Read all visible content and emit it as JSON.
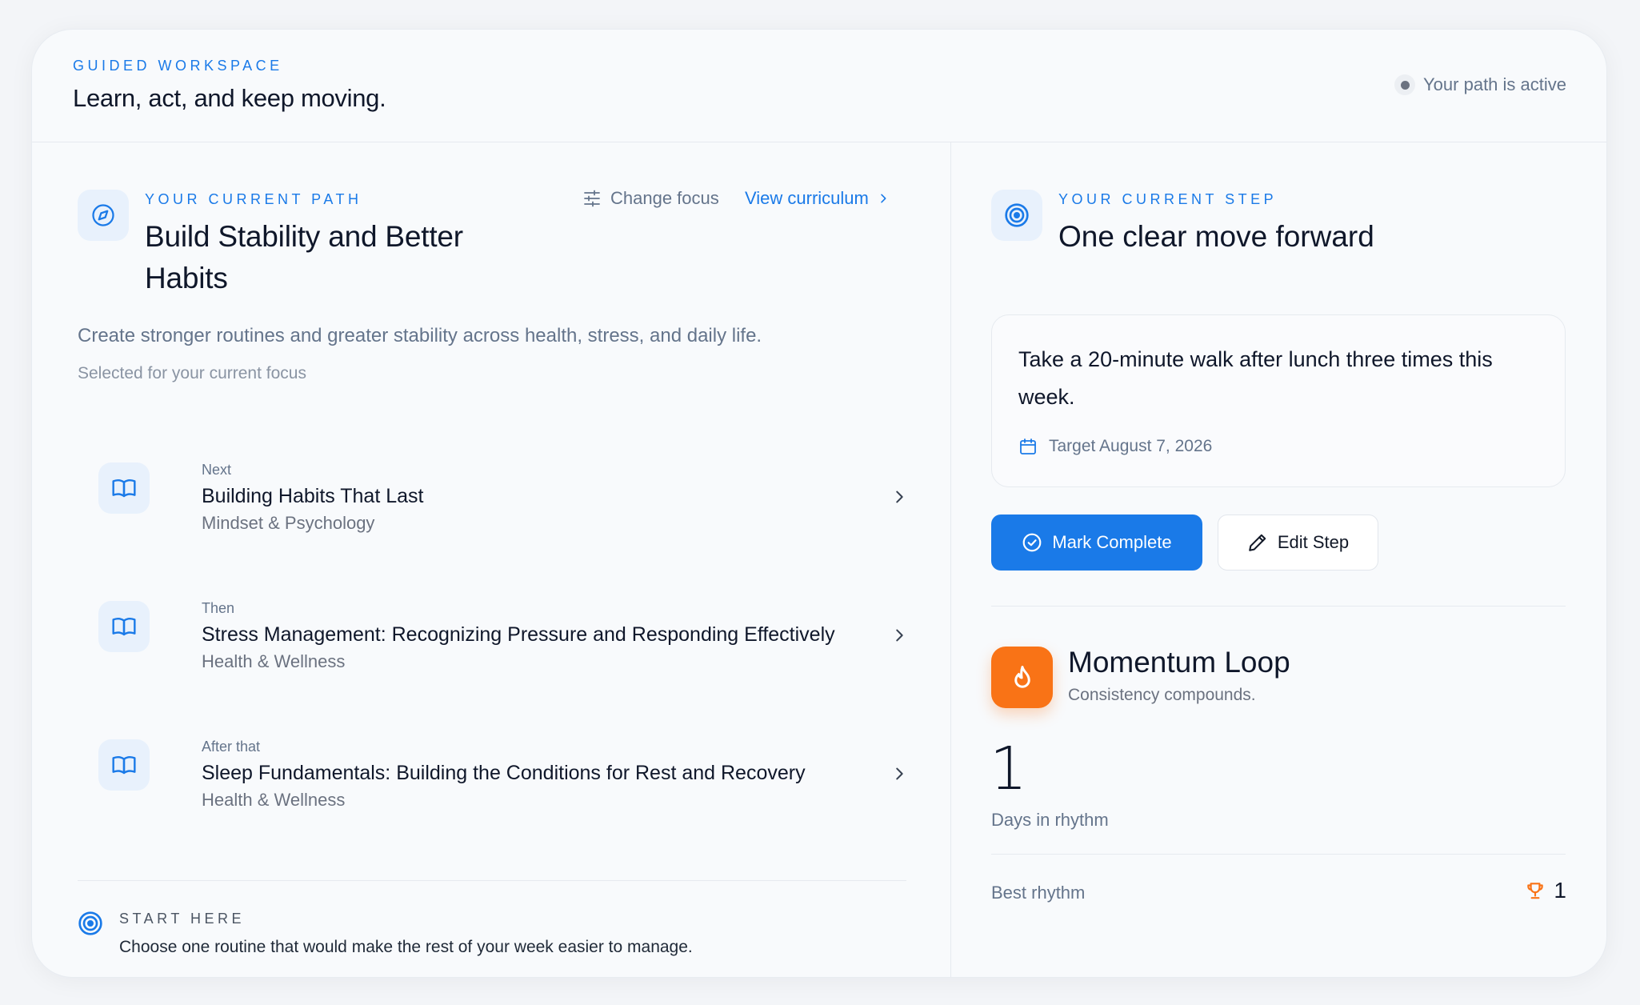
{
  "header": {
    "eyebrow": "GUIDED WORKSPACE",
    "title": "Learn, act, and keep moving.",
    "status": "Your path is active"
  },
  "path": {
    "icon": "compass-icon",
    "eyebrow": "YOUR CURRENT PATH",
    "title": "Build Stability and Better Habits",
    "change_focus_label": "Change focus",
    "view_curriculum_label": "View curriculum",
    "description": "Create stronger routines and greater stability across health, stress, and daily life.",
    "subtext": "Selected for your current focus",
    "lessons": [
      {
        "step": "Next",
        "title": "Building Habits That Last",
        "category": "Mindset & Psychology",
        "icon": "book-icon"
      },
      {
        "step": "Then",
        "title": "Stress Management: Recognizing Pressure and Responding Effectively",
        "category": "Health & Wellness",
        "icon": "book-icon"
      },
      {
        "step": "After that",
        "title": "Sleep Fundamentals: Building the Conditions for Rest and Recovery",
        "category": "Health & Wellness",
        "icon": "book-icon"
      }
    ],
    "start_here": {
      "eyebrow": "START HERE",
      "text": "Choose one routine that would make the rest of your week easier to manage."
    }
  },
  "step": {
    "icon": "target-icon",
    "eyebrow": "YOUR CURRENT STEP",
    "title": "One clear move forward",
    "text": "Take a 20-minute walk after lunch three times this week.",
    "target": "Target August 7, 2026",
    "mark_complete_label": "Mark Complete",
    "edit_step_label": "Edit Step"
  },
  "momentum": {
    "title": "Momentum Loop",
    "subtitle": "Consistency compounds.",
    "days": "1",
    "days_label": "Days in rhythm",
    "best_label": "Best rhythm",
    "best_value": "1"
  },
  "colors": {
    "accent": "#1a7ae8",
    "flame": "#f97316",
    "background": "#f8fafc"
  }
}
